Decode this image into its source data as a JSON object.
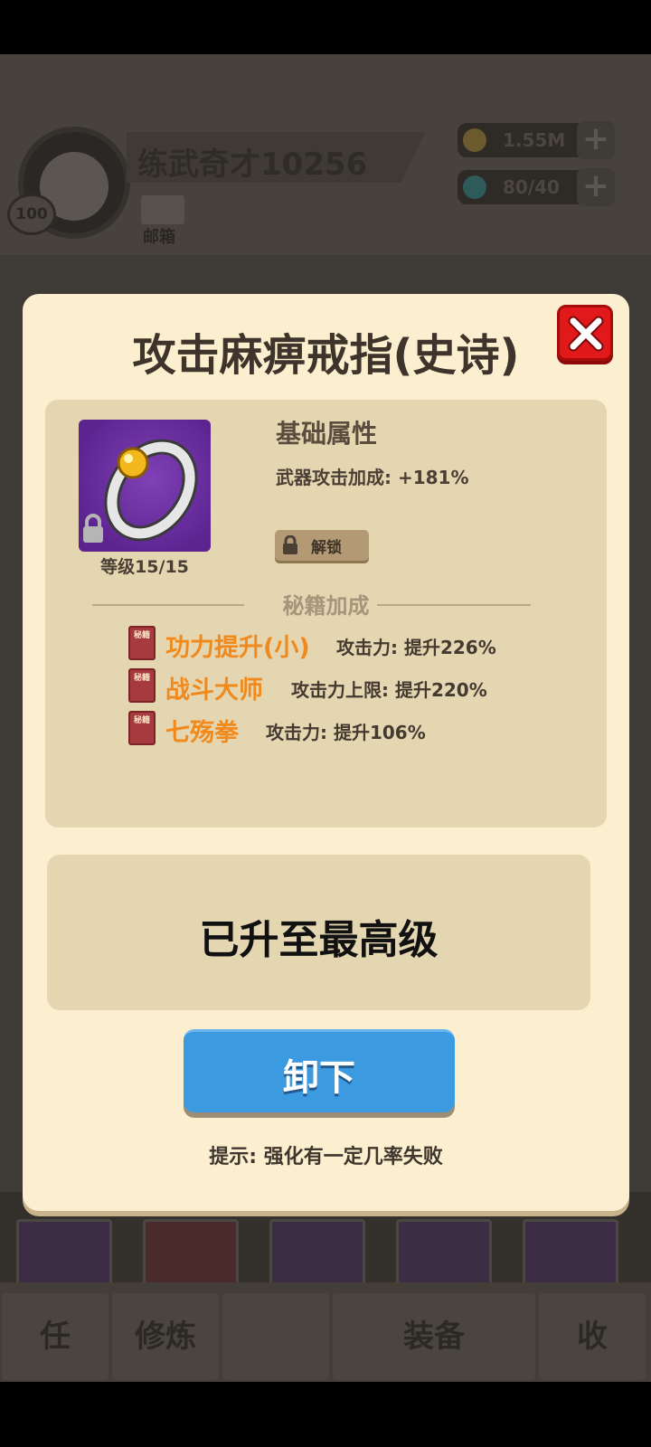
{
  "background": {
    "player_name": "练武奇才10256",
    "player_level": "100",
    "mail_label": "邮箱",
    "gold": "1.55M",
    "energy": "80/40",
    "nav_items": [
      "任",
      "修炼",
      "",
      "装备",
      "收"
    ]
  },
  "dialog": {
    "title": "攻击麻痹戒指(史诗)",
    "item": {
      "icon": "ring-icon",
      "level_text": "等级15/15"
    },
    "base_attr": {
      "title": "基础属性",
      "line": "武器攻击加成: +181%"
    },
    "unlock_label": "解锁",
    "secret": {
      "title": "秘籍加成",
      "book_glyph": "秘籍",
      "items": [
        {
          "name": "功力提升(小)",
          "effect": "攻击力: 提升226%"
        },
        {
          "name": "战斗大师",
          "effect": "攻击力上限: 提升220%"
        },
        {
          "name": "七殇拳",
          "effect": "攻击力: 提升106%"
        }
      ]
    },
    "max_text": "已升至最高级",
    "unequip_label": "卸下",
    "hint": "提示: 强化有一定几率失败"
  },
  "colors": {
    "dialog_bg": "#fbefcf",
    "panel_bg": "#e5d6b2",
    "close_red": "#e2191a",
    "button_blue": "#3c9ae1",
    "secret_orange": "#f08a1c",
    "item_purple": "#6a2fa0"
  }
}
